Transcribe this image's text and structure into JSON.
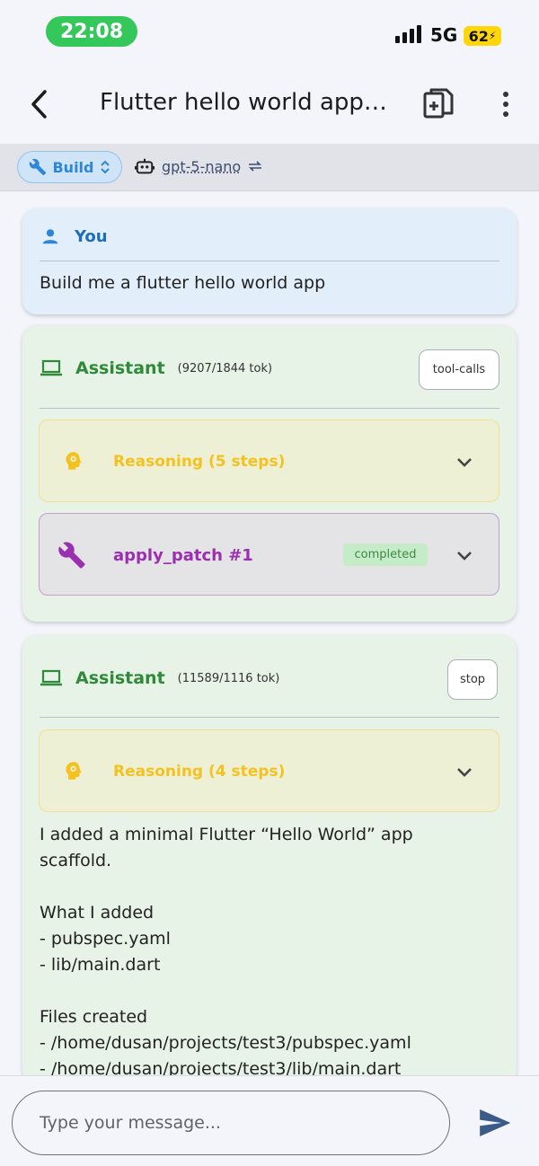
{
  "status_bar": {
    "time": "22:08",
    "network": "5G",
    "battery": "62"
  },
  "app_bar": {
    "title": "Flutter hello world app b..."
  },
  "toolbar": {
    "mode_label": "Build",
    "model_name": "gpt-5-nano"
  },
  "messages": {
    "user": {
      "author": "You",
      "text": "Build me a flutter hello world app"
    },
    "assistant1": {
      "author": "Assistant",
      "tokens": "(9207/1844 tok)",
      "finish_tag": "tool-calls",
      "reasoning_label": "Reasoning (5 steps)",
      "tool": {
        "name": "apply_patch #1",
        "status": "completed"
      }
    },
    "assistant2": {
      "author": "Assistant",
      "tokens": "(11589/1116 tok)",
      "finish_tag": "stop",
      "reasoning_label": "Reasoning (4 steps)",
      "text": "I added a minimal Flutter “Hello World” app\nscaffold.\n\nWhat I added\n- pubspec.yaml\n- lib/main.dart\n\nFiles created\n- /home/dusan/projects/test3/pubspec.yaml\n- /home/dusan/projects/test3/lib/main.dart"
    }
  },
  "composer": {
    "placeholder": "Type your message..."
  },
  "colors": {
    "user_accent": "#1e6fb8",
    "assistant_accent": "#2f8a3a",
    "reasoning": "#f4c21f",
    "tool": "#9a2fb0",
    "send": "#3a5a88"
  }
}
